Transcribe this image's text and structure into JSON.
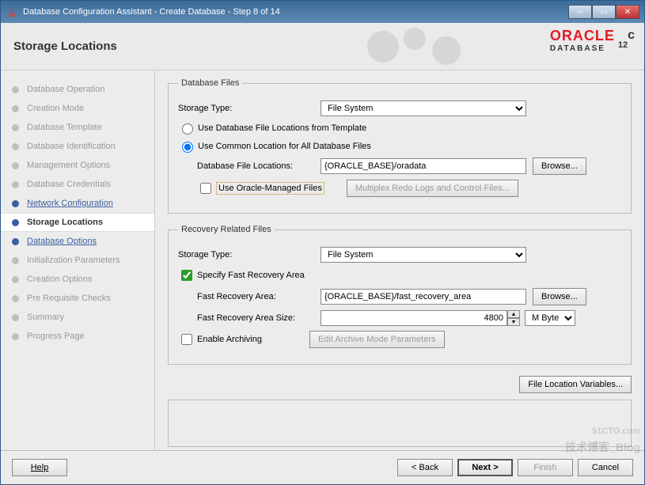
{
  "window": {
    "title": "Database Configuration Assistant - Create Database - Step 8 of 14",
    "page_title": "Storage Locations"
  },
  "logo": {
    "brand": "ORACLE",
    "sub": "DATABASE",
    "version": "12",
    "suffix": "c"
  },
  "sidebar": {
    "items": [
      {
        "label": "Database Operation",
        "state": "dim"
      },
      {
        "label": "Creation Mode",
        "state": "dim"
      },
      {
        "label": "Database Template",
        "state": "dim"
      },
      {
        "label": "Database Identification",
        "state": "dim"
      },
      {
        "label": "Management Options",
        "state": "dim"
      },
      {
        "label": "Database Credentials",
        "state": "dim"
      },
      {
        "label": "Network Configuration",
        "state": "link"
      },
      {
        "label": "Storage Locations",
        "state": "current"
      },
      {
        "label": "Database Options",
        "state": "link"
      },
      {
        "label": "Initialization Parameters",
        "state": "dim"
      },
      {
        "label": "Creation Options",
        "state": "dim"
      },
      {
        "label": "Pre Requisite Checks",
        "state": "dim"
      },
      {
        "label": "Summary",
        "state": "dim"
      },
      {
        "label": "Progress Page",
        "state": "dim"
      }
    ]
  },
  "dbfiles": {
    "legend": "Database Files",
    "storage_type_label": "Storage Type:",
    "storage_type_value": "File System",
    "radio_template": "Use Database File Locations from Template",
    "radio_common": "Use Common Location for All Database Files",
    "radio_selected": "common",
    "file_loc_label": "Database File Locations:",
    "file_loc_value": "{ORACLE_BASE}/oradata",
    "browse": "Browse...",
    "omf_label": "Use Oracle-Managed Files",
    "omf_checked": false,
    "multiplex_btn": "Multiplex Redo Logs and Control Files..."
  },
  "recovery": {
    "legend": "Recovery Related Files",
    "storage_type_label": "Storage Type:",
    "storage_type_value": "File System",
    "specify_label": "Specify Fast Recovery Area",
    "specify_checked": true,
    "area_label": "Fast Recovery Area:",
    "area_value": "{ORACLE_BASE}/fast_recovery_area",
    "browse": "Browse...",
    "size_label": "Fast Recovery Area Size:",
    "size_value": "4800",
    "size_unit": "M Bytes",
    "archiving_label": "Enable Archiving",
    "archiving_checked": false,
    "edit_archive_btn": "Edit Archive Mode Parameters"
  },
  "file_loc_vars_btn": "File Location Variables...",
  "footer": {
    "help": "Help",
    "back": "< Back",
    "next": "Next >",
    "finish": "Finish",
    "cancel": "Cancel"
  },
  "watermark": {
    "main": "51CTO.com",
    "sub": "技术博客_Blog"
  }
}
